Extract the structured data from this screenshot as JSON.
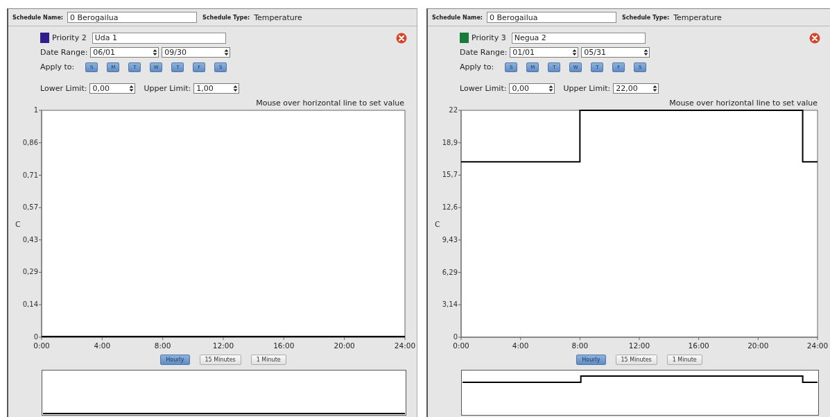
{
  "panels": [
    {
      "schedule_name_label": "Schedule Name:",
      "schedule_name": "0 Berogailua",
      "schedule_type_label": "Schedule Type:",
      "schedule_type": "Temperature",
      "priority": {
        "label": "Priority 2",
        "color": "#2e1f8c",
        "name": "Uda 1"
      },
      "date_range": {
        "label": "Date Range:",
        "start": "06/01",
        "end": "09/30"
      },
      "apply_to": {
        "label": "Apply to:",
        "days": [
          {
            "label": "S",
            "selected": true
          },
          {
            "label": "M",
            "selected": true
          },
          {
            "label": "T",
            "selected": true
          },
          {
            "label": "W",
            "selected": true
          },
          {
            "label": "T",
            "selected": true
          },
          {
            "label": "F",
            "selected": true
          },
          {
            "label": "S",
            "selected": true
          }
        ]
      },
      "lower_limit": {
        "label": "Lower Limit:",
        "value": "0,00"
      },
      "upper_limit": {
        "label": "Upper Limit:",
        "value": "1,00"
      },
      "hint": "Mouse over horizontal line to set value",
      "chart_data": {
        "type": "line",
        "ylabel": "C",
        "x": [
          0,
          24
        ],
        "series": [
          {
            "color": "#000000",
            "values": [
              0,
              0
            ]
          }
        ],
        "xlim": [
          0,
          24
        ],
        "ylim": [
          0,
          1
        ],
        "xticks": [
          {
            "value": 0,
            "label": "0:00"
          },
          {
            "value": 4,
            "label": "4:00"
          },
          {
            "value": 8,
            "label": "8:00"
          },
          {
            "value": 12,
            "label": "12:00"
          },
          {
            "value": 16,
            "label": "16:00"
          },
          {
            "value": 20,
            "label": "20:00"
          },
          {
            "value": 24,
            "label": "24:00"
          }
        ],
        "yticks": [
          {
            "value": 0,
            "label": "0"
          },
          {
            "value": 0.143,
            "label": "0,14"
          },
          {
            "value": 0.286,
            "label": "0,29"
          },
          {
            "value": 0.429,
            "label": "0,43"
          },
          {
            "value": 0.571,
            "label": "0,57"
          },
          {
            "value": 0.714,
            "label": "0,71"
          },
          {
            "value": 0.857,
            "label": "0,86"
          },
          {
            "value": 1,
            "label": "1"
          }
        ]
      },
      "resolutions": [
        {
          "label": "Hourly",
          "selected": true
        },
        {
          "label": "15 Minutes",
          "selected": false
        },
        {
          "label": "1 Minute",
          "selected": false
        }
      ]
    },
    {
      "schedule_name_label": "Schedule Name:",
      "schedule_name": "0 Berogailua",
      "schedule_type_label": "Schedule Type:",
      "schedule_type": "Temperature",
      "priority": {
        "label": "Priority 3",
        "color": "#1a7a3a",
        "name": "Negua 2"
      },
      "date_range": {
        "label": "Date Range:",
        "start": "01/01",
        "end": "05/31"
      },
      "apply_to": {
        "label": "Apply to:",
        "days": [
          {
            "label": "S",
            "selected": true
          },
          {
            "label": "M",
            "selected": true
          },
          {
            "label": "T",
            "selected": true
          },
          {
            "label": "W",
            "selected": true
          },
          {
            "label": "T",
            "selected": true
          },
          {
            "label": "F",
            "selected": true
          },
          {
            "label": "S",
            "selected": true
          }
        ]
      },
      "lower_limit": {
        "label": "Lower Limit:",
        "value": "0,00"
      },
      "upper_limit": {
        "label": "Upper Limit:",
        "value": "22,00"
      },
      "hint": "Mouse over horizontal line to set value",
      "chart_data": {
        "type": "line",
        "ylabel": "C",
        "x": [
          0,
          8,
          8,
          23,
          23,
          24
        ],
        "series": [
          {
            "color": "#000000",
            "values": [
              17,
              17,
              22,
              22,
              17,
              17
            ]
          }
        ],
        "xlim": [
          0,
          24
        ],
        "ylim": [
          0,
          22
        ],
        "xticks": [
          {
            "value": 0,
            "label": "0:00"
          },
          {
            "value": 4,
            "label": "4:00"
          },
          {
            "value": 8,
            "label": "8:00"
          },
          {
            "value": 12,
            "label": "12:00"
          },
          {
            "value": 16,
            "label": "16:00"
          },
          {
            "value": 20,
            "label": "20:00"
          },
          {
            "value": 24,
            "label": "24:00"
          }
        ],
        "yticks": [
          {
            "value": 0,
            "label": "0"
          },
          {
            "value": 3.143,
            "label": "3,14"
          },
          {
            "value": 6.286,
            "label": "6,29"
          },
          {
            "value": 9.429,
            "label": "9,43"
          },
          {
            "value": 12.571,
            "label": "12,6"
          },
          {
            "value": 15.714,
            "label": "15,7"
          },
          {
            "value": 18.857,
            "label": "18,9"
          },
          {
            "value": 22,
            "label": "22"
          }
        ]
      },
      "resolutions": [
        {
          "label": "Hourly",
          "selected": true
        },
        {
          "label": "15 Minutes",
          "selected": false
        },
        {
          "label": "1 Minute",
          "selected": false
        }
      ]
    }
  ]
}
